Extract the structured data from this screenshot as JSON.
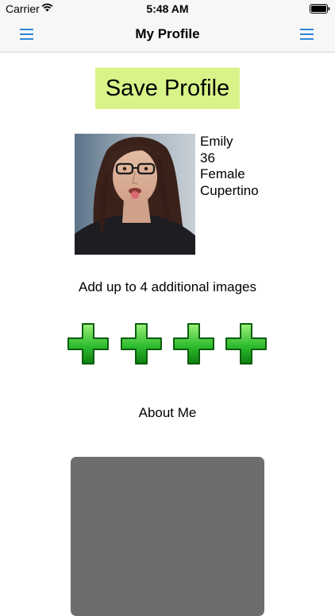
{
  "status_bar": {
    "carrier": "Carrier",
    "time": "5:48 AM"
  },
  "nav": {
    "title": "My Profile",
    "left_icon": "hamburger-menu-icon",
    "right_icon": "hamburger-menu-icon",
    "icon_color": "#2f86d8"
  },
  "save_button": {
    "label": "Save Profile",
    "color": "#d8f488"
  },
  "profile": {
    "name": "Emily",
    "age": "36",
    "gender": "Female",
    "location": "Cupertino"
  },
  "additional_images": {
    "label": "Add up to 4 additional images",
    "slots": 4,
    "slot_icon": "green-plus-icon"
  },
  "about": {
    "label": "About Me",
    "text": "",
    "box_color": "#6d6d6d"
  }
}
